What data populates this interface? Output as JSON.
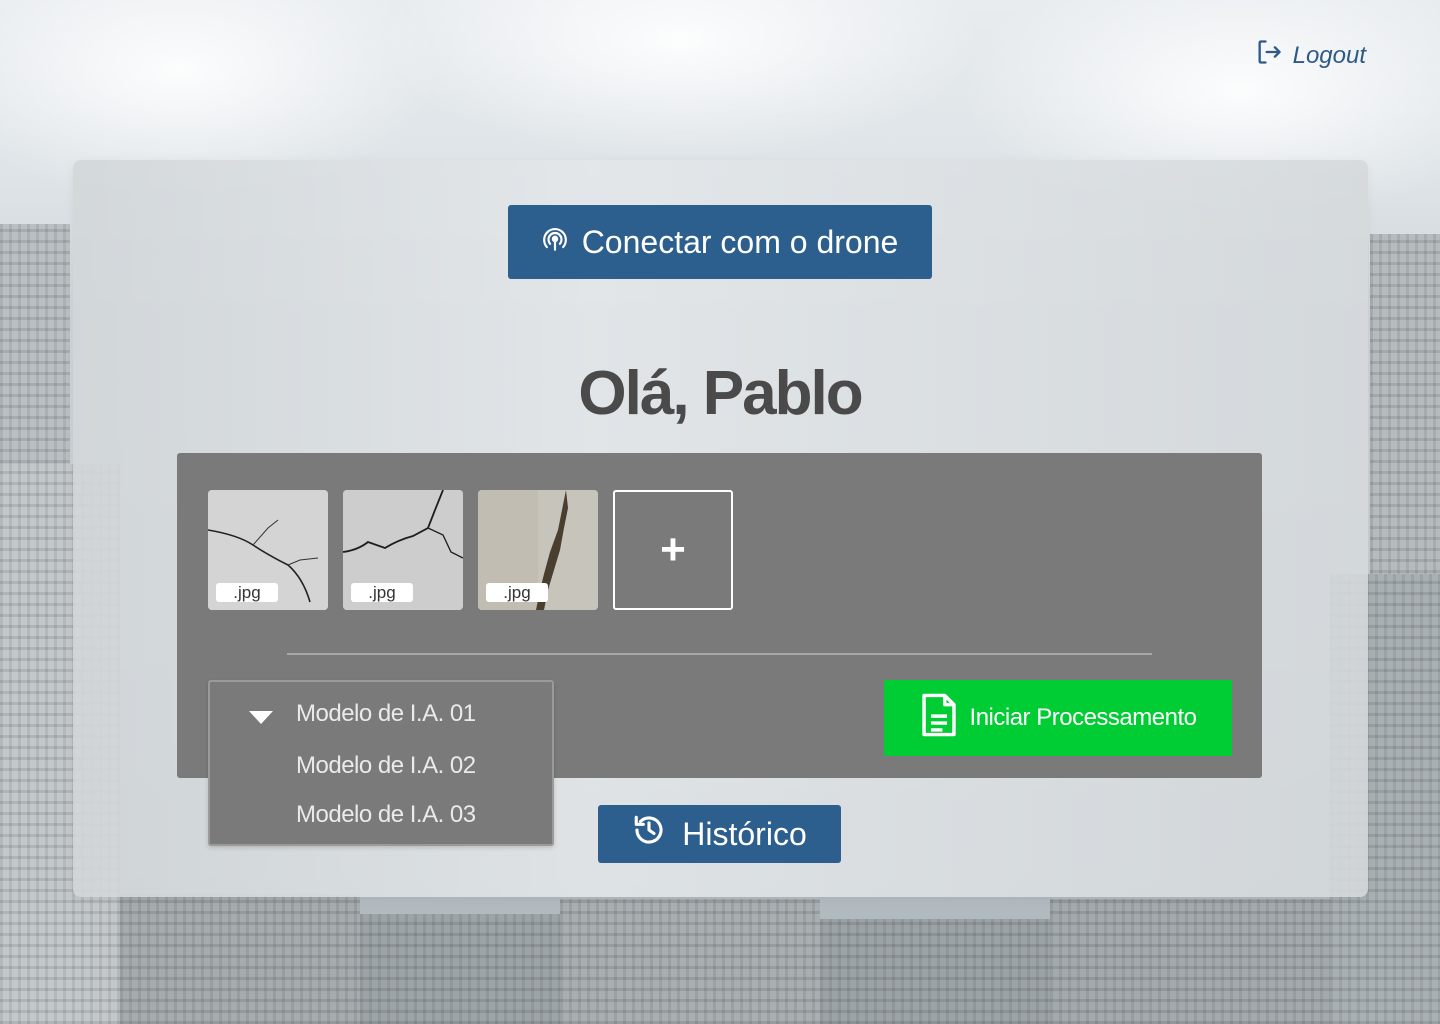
{
  "header": {
    "logout_label": "Logout",
    "logout_icon": "logout-icon"
  },
  "actions": {
    "connect_drone_label": "Conectar com o drone",
    "connect_drone_icon": "broadcast-icon",
    "history_label": "Histórico",
    "history_icon": "history-icon",
    "process_label": "Iniciar Processamento",
    "process_icon": "document-icon"
  },
  "greeting": "Olá, Pablo",
  "uploads": {
    "images": [
      {
        "ext": ".jpg"
      },
      {
        "ext": ".jpg"
      },
      {
        "ext": ".jpg"
      }
    ],
    "add_label": "+"
  },
  "model_select": {
    "options": [
      "Modelo de I.A. 01",
      "Modelo de I.A. 02",
      "Modelo de I.A. 03"
    ],
    "selected": "Modelo de I.A. 01"
  },
  "colors": {
    "primary": "#2d5f8e",
    "success": "#00cc33",
    "panel": "#7a7a7a",
    "text_dark": "#4a4a4a"
  }
}
